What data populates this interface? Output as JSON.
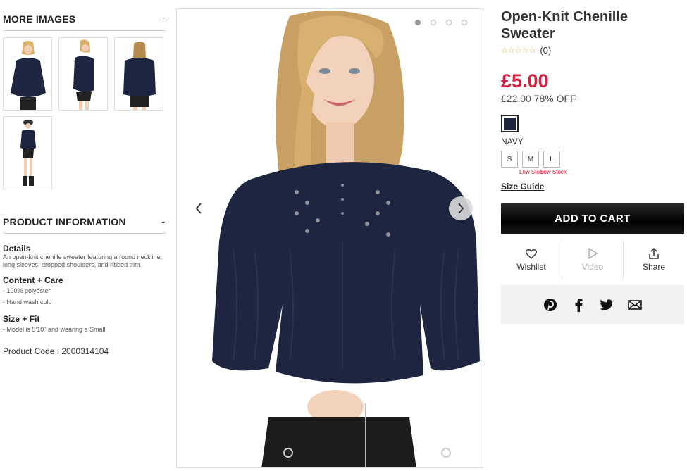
{
  "more_images": {
    "title": "MORE IMAGES",
    "toggle": "-",
    "thumbnails": [
      "front-view",
      "side-view",
      "back-view",
      "full-length-view"
    ]
  },
  "product_info": {
    "title": "PRODUCT INFORMATION",
    "toggle": "-",
    "details_title": "Details",
    "details_text": "An open-knit chenille sweater featuring a round neckline, long sleeves, dropped shoulders, and ribbed trim.",
    "care_title": "Content + Care",
    "care_items": [
      "- 100% polyester",
      "- Hand wash cold"
    ],
    "fit_title": "Size + Fit",
    "fit_items": [
      "- Model is 5'10\" and wearing a Small"
    ],
    "product_code": "Product Code : 2000314104"
  },
  "gallery": {
    "slide_count": 4,
    "active_slide": 0
  },
  "product": {
    "title": "Open-Knit Chenille Sweater",
    "stars": "☆☆☆☆☆",
    "review_count": "(0)",
    "price": "£5.00",
    "was_price": "£22.00",
    "discount": "78% OFF",
    "color_name": "NAVY",
    "swatch_color": "#1d2540",
    "sizes": [
      {
        "label": "S",
        "note": ""
      },
      {
        "label": "M",
        "note": "Low Stock"
      },
      {
        "label": "L",
        "note": "Low Stock"
      }
    ],
    "size_guide": "Size Guide",
    "add_to_cart": "ADD TO CART",
    "actions": {
      "wishlist": "Wishlist",
      "video": "Video",
      "share": "Share"
    }
  },
  "colors": {
    "price_red": "#d3213f",
    "sweater_navy": "#1d2540"
  }
}
